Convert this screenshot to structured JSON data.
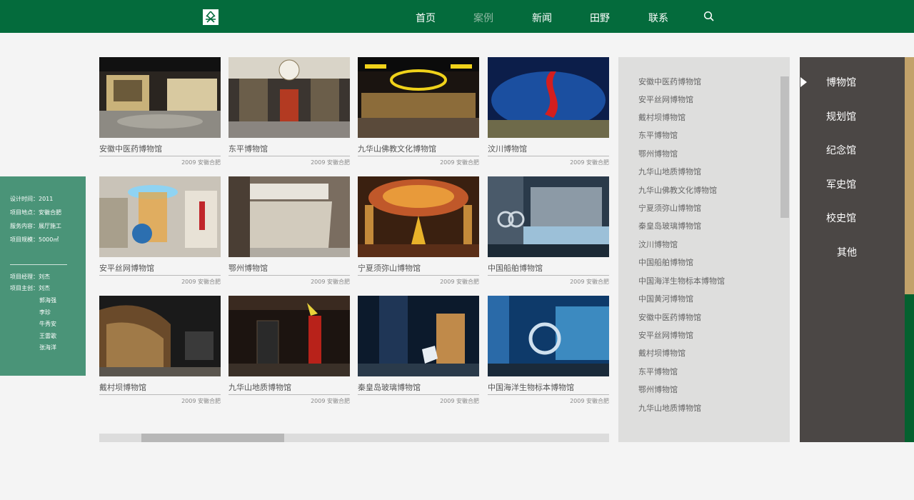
{
  "nav": {
    "items": [
      {
        "label": "首页",
        "active": false
      },
      {
        "label": "案例",
        "active": true
      },
      {
        "label": "新闻",
        "active": false
      },
      {
        "label": "田野",
        "active": false
      },
      {
        "label": "联系",
        "active": false
      }
    ],
    "search_icon": "search-icon"
  },
  "info": {
    "design_time": "设计时间：2011",
    "location": "项目地点：安徽合肥",
    "service": "服务内容：展厅施工",
    "scale": "项目规模：5000㎡",
    "manager": "项目经理：刘杰",
    "lead": "项目主创：刘杰",
    "members": [
      "郭海强",
      "李珍",
      "牛秀安",
      "王雷歌",
      "张海洋"
    ]
  },
  "cases": [
    {
      "title": "安徽中医药博物馆",
      "meta": "2009  安徽合肥"
    },
    {
      "title": "东平博物馆",
      "meta": "2009  安徽合肥"
    },
    {
      "title": "九华山佛教文化博物馆",
      "meta": "2009  安徽合肥"
    },
    {
      "title": "汶川博物馆",
      "meta": "2009  安徽合肥"
    },
    {
      "title": "安平丝网博物馆",
      "meta": "2009  安徽合肥"
    },
    {
      "title": "鄂州博物馆",
      "meta": "2009  安徽合肥"
    },
    {
      "title": "宁夏须弥山博物馆",
      "meta": "2009  安徽合肥"
    },
    {
      "title": "中国船舶博物馆",
      "meta": "2009  安徽合肥"
    },
    {
      "title": "戴村坝博物馆",
      "meta": "2009  安徽合肥"
    },
    {
      "title": "九华山地质博物馆",
      "meta": "2009  安徽合肥"
    },
    {
      "title": "秦皇岛玻璃博物馆",
      "meta": "2009  安徽合肥"
    },
    {
      "title": "中国海洋生物标本博物馆",
      "meta": "2009  安徽合肥"
    }
  ],
  "museum_list": [
    "安徽中医药博物馆",
    "安平丝网博物馆",
    "戴村坝博物馆",
    "东平博物馆",
    "鄂州博物馆",
    "九华山地质博物馆",
    "九华山佛教文化博物馆",
    "宁夏须弥山博物馆",
    "秦皇岛玻璃博物馆",
    "汶川博物馆",
    "中国船舶博物馆",
    "中国海洋生物标本博物馆",
    "中国黄河博物馆",
    "安徽中医药博物馆",
    "安平丝网博物馆",
    "戴村坝博物馆",
    "东平博物馆",
    "鄂州博物馆",
    "九华山地质博物馆"
  ],
  "categories": [
    "博物馆",
    "规划馆",
    "纪念馆",
    "军史馆",
    "校史馆",
    "其他"
  ],
  "colors": {
    "header": "#046b3c",
    "info_panel": "#4a9478",
    "category_panel": "#4b4745",
    "accent_gold": "#c2a26a",
    "accent_green": "#04612f"
  }
}
